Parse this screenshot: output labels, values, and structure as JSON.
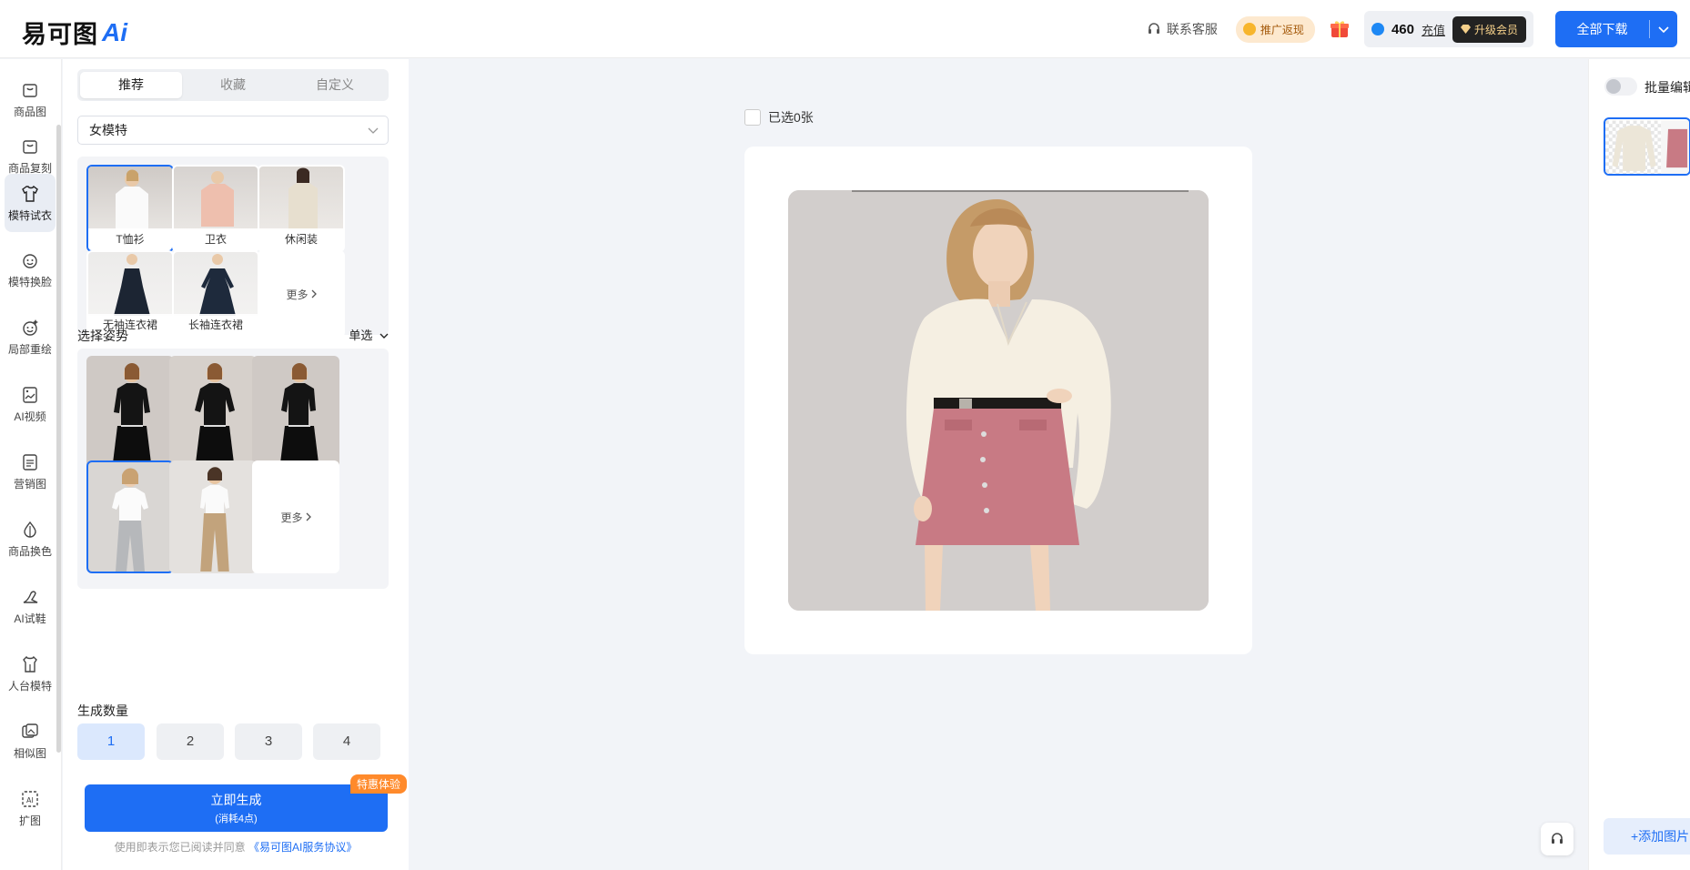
{
  "header": {
    "logo_text": "易可图",
    "logo_ai": "Ai",
    "customer_service": "联系客服",
    "promo": "推广返现",
    "points": "460",
    "recharge": "充值",
    "upgrade": "升级会员",
    "download_all": "全部下载"
  },
  "sidebar": {
    "items": [
      {
        "label": "商品图",
        "icon": "bag-icon"
      },
      {
        "label": "商品复刻",
        "icon": "bag-copy-icon"
      },
      {
        "label": "模特试衣",
        "icon": "tshirt-icon"
      },
      {
        "label": "模特换脸",
        "icon": "face-swap-icon"
      },
      {
        "label": "局部重绘",
        "icon": "face-edit-icon"
      },
      {
        "label": "AI视频",
        "icon": "video-icon"
      },
      {
        "label": "营销图",
        "icon": "marketing-icon"
      },
      {
        "label": "商品换色",
        "icon": "color-drop-icon"
      },
      {
        "label": "AI试鞋",
        "icon": "shoe-icon"
      },
      {
        "label": "人台模特",
        "icon": "mannequin-icon"
      },
      {
        "label": "相似图",
        "icon": "similar-image-icon"
      },
      {
        "label": "扩图",
        "icon": "expand-image-icon"
      }
    ]
  },
  "panel": {
    "tabs": [
      "推荐",
      "收藏",
      "自定义"
    ],
    "category_select": "女模特",
    "clothing": [
      "T恤衫",
      "卫衣",
      "休闲装",
      "无袖连衣裙",
      "长袖连衣裙"
    ],
    "more": "更多",
    "pose_title": "选择姿势",
    "pose_mode": "单选",
    "count_title": "生成数量",
    "counts": [
      "1",
      "2",
      "3",
      "4"
    ],
    "generate_label": "立即生成",
    "generate_cost": "(消耗4点)",
    "badge": "特惠体验",
    "agreement_prefix": "使用即表示您已阅读并同意",
    "agreement_link": "《易可图AI服务协议》"
  },
  "canvas": {
    "selected_text": "已选0张"
  },
  "right": {
    "batch_edit": "批量编辑",
    "add_image": "+添加图片"
  },
  "colors": {
    "accent": "#1e6ef4",
    "badge": "#ff8a2b"
  }
}
